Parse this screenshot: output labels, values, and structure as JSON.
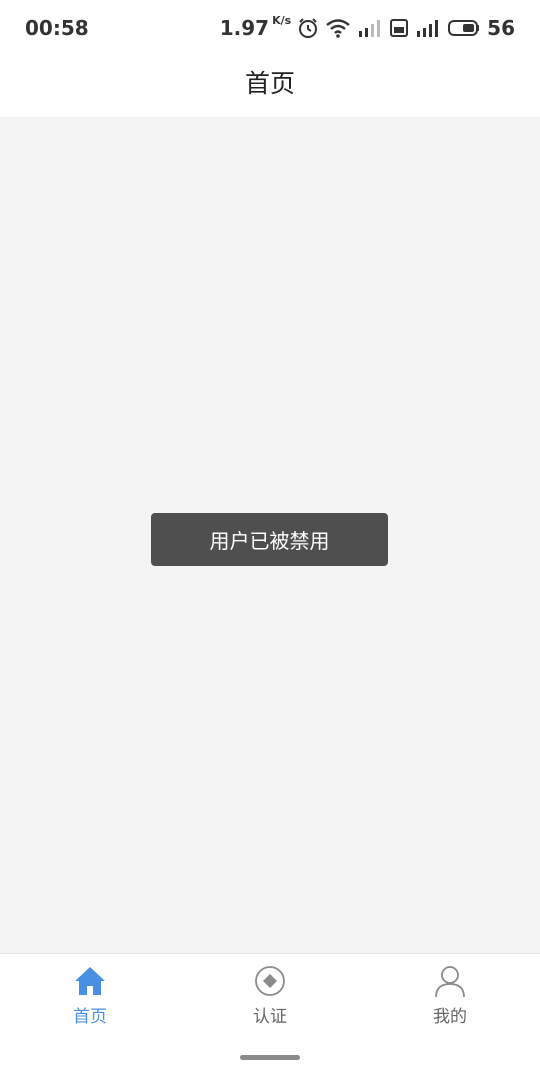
{
  "status_bar": {
    "time": "00:58",
    "speed_value": "1.97",
    "speed_unit": "K/s",
    "battery": "56",
    "icons": [
      "alarm-icon",
      "wifi-icon",
      "signal-4g-icon",
      "hd-icon",
      "signal-4g-icon",
      "battery-icon"
    ]
  },
  "header": {
    "title": "首页"
  },
  "toast": {
    "message": "用户已被禁用"
  },
  "tab_bar": {
    "tabs": [
      {
        "label": "首页",
        "icon": "home-icon",
        "active": true
      },
      {
        "label": "认证",
        "icon": "certification-icon",
        "active": false
      },
      {
        "label": "我的",
        "icon": "user-icon",
        "active": false
      }
    ],
    "active_color": "#4a90e2",
    "inactive_color": "#666666"
  },
  "colors": {
    "background": "#f4f4f4",
    "toast_background": "#4f4f4f"
  }
}
